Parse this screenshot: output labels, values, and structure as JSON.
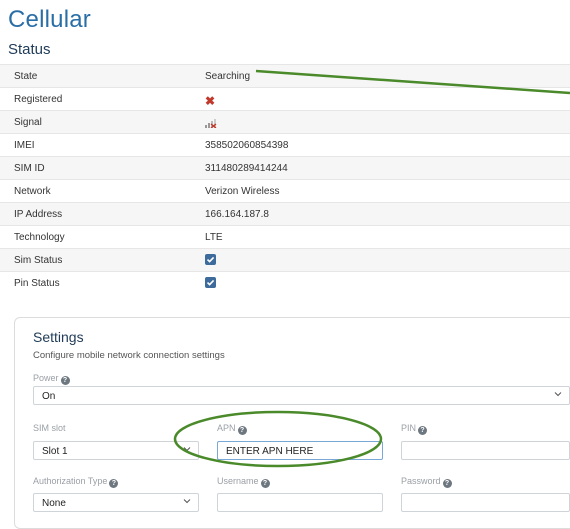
{
  "page": {
    "title": "Cellular"
  },
  "status": {
    "title": "Status",
    "rows": [
      {
        "label": "State",
        "value": "Searching"
      },
      {
        "label": "Registered",
        "value": "✖"
      },
      {
        "label": "Signal",
        "value": ""
      },
      {
        "label": "IMEI",
        "value": "358502060854398"
      },
      {
        "label": "SIM ID",
        "value": "311480289414244"
      },
      {
        "label": "Network",
        "value": "Verizon Wireless"
      },
      {
        "label": "IP Address",
        "value": "166.164.187.8"
      },
      {
        "label": "Technology",
        "value": "LTE"
      },
      {
        "label": "Sim Status",
        "checked": true
      },
      {
        "label": "Pin Status",
        "checked": true
      }
    ]
  },
  "settings": {
    "title": "Settings",
    "description": "Configure mobile network connection settings",
    "power": {
      "label": "Power",
      "value": "On"
    },
    "sim_slot": {
      "label": "SIM slot",
      "value": "Slot 1"
    },
    "apn": {
      "label": "APN",
      "value": "ENTER APN HERE"
    },
    "pin": {
      "label": "PIN",
      "value": ""
    },
    "auth_type": {
      "label": "Authorization Type",
      "value": "None"
    },
    "username": {
      "label": "Username",
      "value": ""
    },
    "password": {
      "label": "Password",
      "value": ""
    }
  },
  "colors": {
    "accent": "#2a6ea6",
    "annotation": "#4a8a2a",
    "error": "#c0392b",
    "checkbox": "#3d6b9c"
  }
}
